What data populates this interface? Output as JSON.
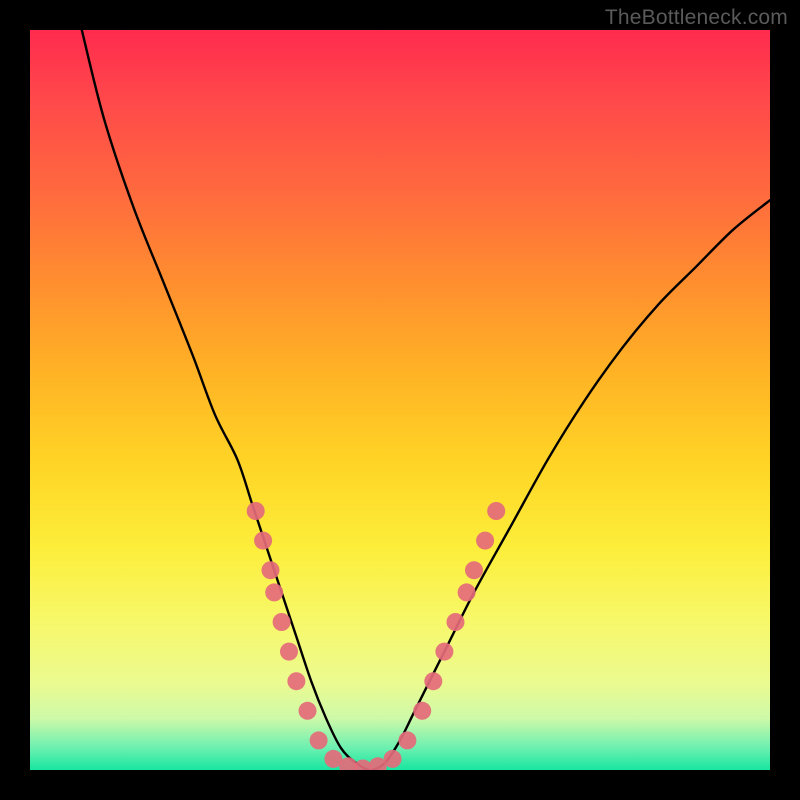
{
  "watermark": "TheBottleneck.com",
  "chart_data": {
    "type": "line",
    "title": "",
    "xlabel": "",
    "ylabel": "",
    "xlim": [
      0,
      100
    ],
    "ylim": [
      0,
      100
    ],
    "grid": false,
    "background_gradient": {
      "top": "#ff2b4e",
      "middle": "#ffd325",
      "bottom": "#17e6a0"
    },
    "series": [
      {
        "name": "bottleneck-curve",
        "color": "#000000",
        "x": [
          7,
          10,
          14,
          18,
          22,
          25,
          28,
          30,
          32,
          34,
          36,
          38,
          40,
          42,
          44,
          46,
          48,
          50,
          52,
          56,
          60,
          65,
          70,
          75,
          80,
          85,
          90,
          95,
          100
        ],
        "y": [
          100,
          88,
          76,
          66,
          56,
          48,
          42,
          36,
          30,
          24,
          18,
          12,
          7,
          3,
          1,
          0,
          1,
          4,
          8,
          16,
          24,
          33,
          42,
          50,
          57,
          63,
          68,
          73,
          77
        ]
      }
    ],
    "markers": {
      "name": "sample-points",
      "color": "#e46a7a",
      "radius": 9,
      "points": [
        {
          "x": 30.5,
          "y": 35
        },
        {
          "x": 31.5,
          "y": 31
        },
        {
          "x": 32.5,
          "y": 27
        },
        {
          "x": 33.0,
          "y": 24
        },
        {
          "x": 34.0,
          "y": 20
        },
        {
          "x": 35.0,
          "y": 16
        },
        {
          "x": 36.0,
          "y": 12
        },
        {
          "x": 37.5,
          "y": 8
        },
        {
          "x": 39.0,
          "y": 4
        },
        {
          "x": 41.0,
          "y": 1.5
        },
        {
          "x": 43.0,
          "y": 0.5
        },
        {
          "x": 45.0,
          "y": 0.2
        },
        {
          "x": 47.0,
          "y": 0.5
        },
        {
          "x": 49.0,
          "y": 1.5
        },
        {
          "x": 51.0,
          "y": 4
        },
        {
          "x": 53.0,
          "y": 8
        },
        {
          "x": 54.5,
          "y": 12
        },
        {
          "x": 56.0,
          "y": 16
        },
        {
          "x": 57.5,
          "y": 20
        },
        {
          "x": 59.0,
          "y": 24
        },
        {
          "x": 60.0,
          "y": 27
        },
        {
          "x": 61.5,
          "y": 31
        },
        {
          "x": 63.0,
          "y": 35
        }
      ]
    }
  }
}
